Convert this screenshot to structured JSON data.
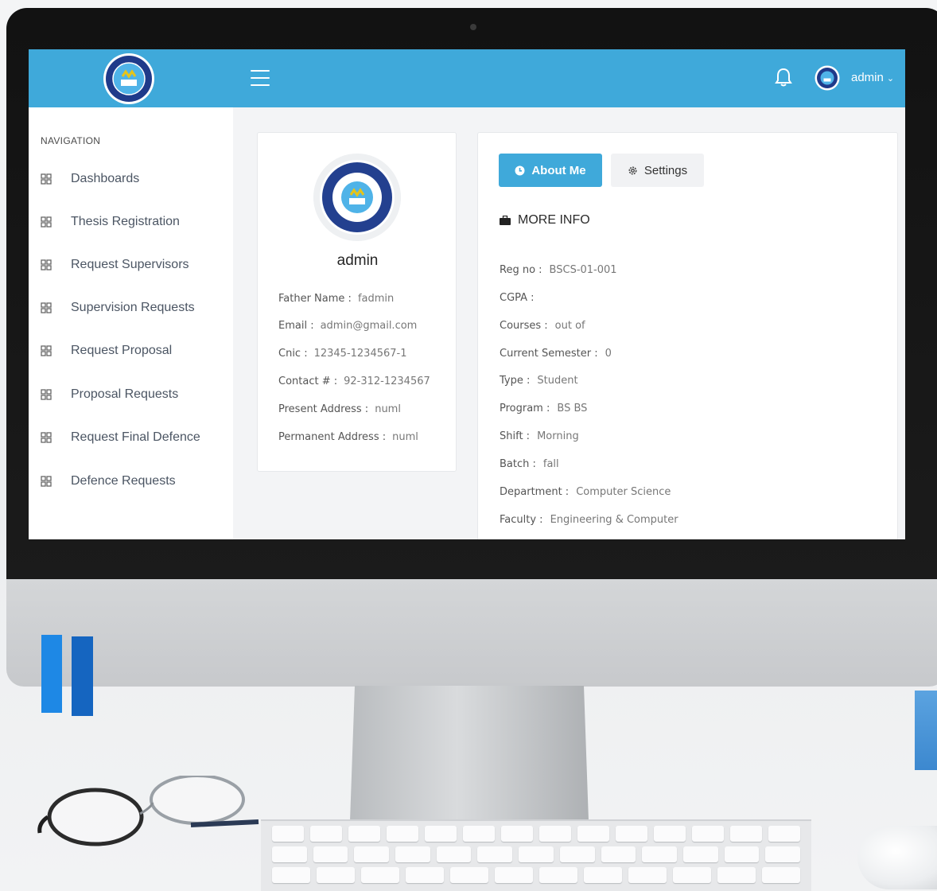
{
  "header": {
    "user_name": "admin",
    "user_chevron": "⌄",
    "icons": [
      "logo",
      "hamburger-icon",
      "bell-icon",
      "avatar"
    ]
  },
  "sidebar": {
    "title": "NAVIGATION",
    "items": [
      {
        "label": "Dashboards"
      },
      {
        "label": "Thesis Registration"
      },
      {
        "label": "Request Supervisors"
      },
      {
        "label": "Supervision Requests"
      },
      {
        "label": "Request Proposal"
      },
      {
        "label": "Proposal Requests"
      },
      {
        "label": "Request Final Defence"
      },
      {
        "label": "Defence Requests"
      }
    ]
  },
  "profile": {
    "name": "admin",
    "fields": [
      {
        "key": "Father Name :",
        "value": "fadmin"
      },
      {
        "key": "Email :",
        "value": "admin@gmail.com"
      },
      {
        "key": "Cnic :",
        "value": "12345-1234567-1"
      },
      {
        "key": "Contact # :",
        "value": "92-312-1234567"
      },
      {
        "key": "Present Address :",
        "value": "numl"
      },
      {
        "key": "Permanent Address :",
        "value": "numl"
      }
    ]
  },
  "tabs": {
    "about_label": "About Me",
    "settings_label": "Settings"
  },
  "more_info": {
    "title": "MORE INFO",
    "fields": [
      {
        "key": "Reg no :",
        "value": "BSCS-01-001"
      },
      {
        "key": "CGPA :",
        "value": ""
      },
      {
        "key": "Courses :",
        "value": "out of"
      },
      {
        "key": "Current Semester :",
        "value": "0"
      },
      {
        "key": "Type :",
        "value": "Student"
      },
      {
        "key": "Program :",
        "value": "BS BS"
      },
      {
        "key": "Shift :",
        "value": "Morning"
      },
      {
        "key": "Batch :",
        "value": "fall"
      },
      {
        "key": "Department :",
        "value": "Computer Science"
      },
      {
        "key": "Faculty :",
        "value": "Engineering & Computer"
      }
    ]
  },
  "colors": {
    "accent": "#3fa9da",
    "content_bg": "#f3f4f6"
  }
}
